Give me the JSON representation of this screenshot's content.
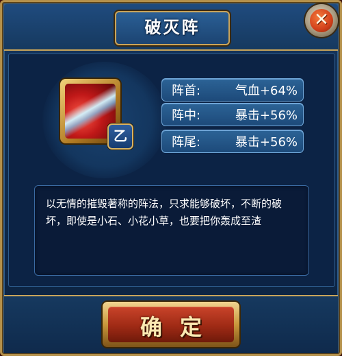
{
  "dialog": {
    "title": "破灭阵",
    "close_icon": "close-x-icon",
    "skill_icon": "slash-skill-icon",
    "grade": "乙",
    "stats": [
      {
        "label": "阵首:",
        "value": "气血+64%"
      },
      {
        "label": "阵中:",
        "value": "暴击+56%"
      },
      {
        "label": "阵尾:",
        "value": "暴击+56%"
      }
    ],
    "description": "以无情的摧毁著称的阵法，只求能够破坏，不断的破坏，即使是小石、小花小草，也要把你轰成至渣",
    "confirm_label": "确定"
  },
  "colors": {
    "frame_blue": "#16365e",
    "gold_border": "#c9a45a",
    "confirm_red": "#9f2a15",
    "text": "#ffffff"
  }
}
